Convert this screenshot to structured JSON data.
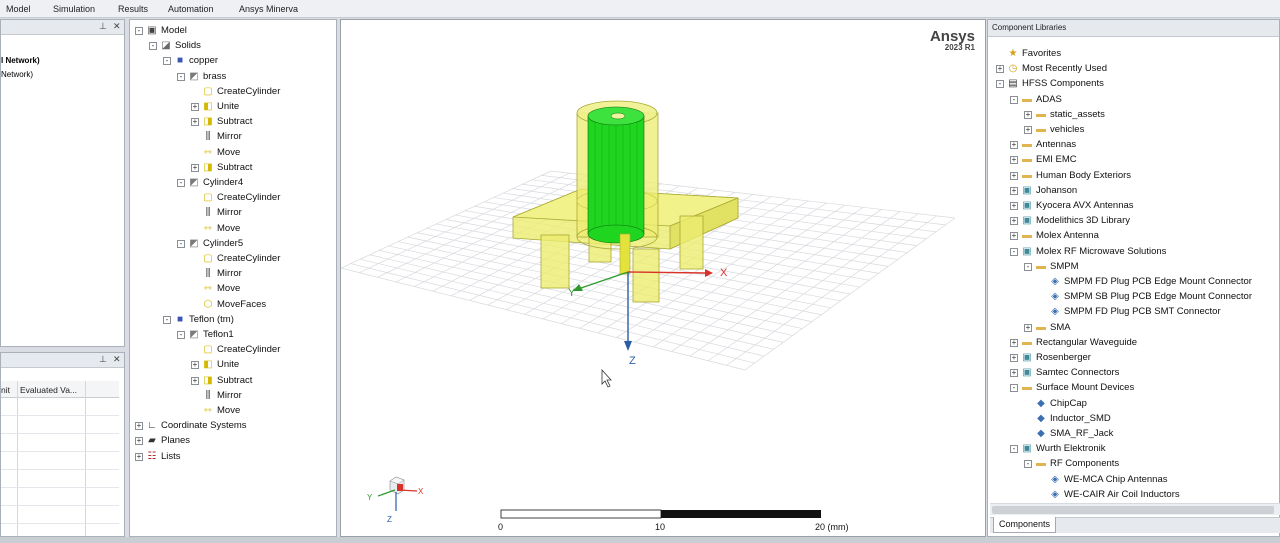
{
  "menu": [
    "Model",
    "Simulation",
    "Results",
    "Automation",
    "Ansys Minerva"
  ],
  "left_panel": {
    "pin_icon": "pin-icon",
    "close_icon": "close-icon",
    "lines": [
      "l Network)",
      "Network)"
    ]
  },
  "props_panel": {
    "pin_icon": "pin-icon",
    "close_icon": "close-icon",
    "columns": [
      "nit",
      "Evaluated Va..."
    ]
  },
  "model_tree": [
    {
      "label": "Model",
      "depth": 0,
      "exp": "-",
      "icon": "model-icon"
    },
    {
      "label": "Solids",
      "depth": 1,
      "exp": "-",
      "icon": "solids-icon"
    },
    {
      "label": "copper",
      "depth": 2,
      "exp": "-",
      "icon": "material-icon"
    },
    {
      "label": "brass",
      "depth": 3,
      "exp": "-",
      "icon": "solid-icon"
    },
    {
      "label": "CreateCylinder",
      "depth": 4,
      "exp": "",
      "icon": "create-cylinder-icon"
    },
    {
      "label": "Unite",
      "depth": 4,
      "exp": "+",
      "icon": "unite-icon"
    },
    {
      "label": "Subtract",
      "depth": 4,
      "exp": "+",
      "icon": "subtract-icon"
    },
    {
      "label": "Mirror",
      "depth": 4,
      "exp": "",
      "icon": "mirror-icon"
    },
    {
      "label": "Move",
      "depth": 4,
      "exp": "",
      "icon": "move-icon"
    },
    {
      "label": "Subtract",
      "depth": 4,
      "exp": "+",
      "icon": "subtract-icon"
    },
    {
      "label": "Cylinder4",
      "depth": 3,
      "exp": "-",
      "icon": "solid-icon"
    },
    {
      "label": "CreateCylinder",
      "depth": 4,
      "exp": "",
      "icon": "create-cylinder-icon"
    },
    {
      "label": "Mirror",
      "depth": 4,
      "exp": "",
      "icon": "mirror-icon"
    },
    {
      "label": "Move",
      "depth": 4,
      "exp": "",
      "icon": "move-icon"
    },
    {
      "label": "Cylinder5",
      "depth": 3,
      "exp": "-",
      "icon": "solid-icon"
    },
    {
      "label": "CreateCylinder",
      "depth": 4,
      "exp": "",
      "icon": "create-cylinder-icon"
    },
    {
      "label": "Mirror",
      "depth": 4,
      "exp": "",
      "icon": "mirror-icon"
    },
    {
      "label": "Move",
      "depth": 4,
      "exp": "",
      "icon": "move-icon"
    },
    {
      "label": "MoveFaces",
      "depth": 4,
      "exp": "",
      "icon": "move-faces-icon"
    },
    {
      "label": "Teflon (tm)",
      "depth": 2,
      "exp": "-",
      "icon": "material-icon"
    },
    {
      "label": "Teflon1",
      "depth": 3,
      "exp": "-",
      "icon": "solid-icon"
    },
    {
      "label": "CreateCylinder",
      "depth": 4,
      "exp": "",
      "icon": "create-cylinder-icon"
    },
    {
      "label": "Unite",
      "depth": 4,
      "exp": "+",
      "icon": "unite-icon"
    },
    {
      "label": "Subtract",
      "depth": 4,
      "exp": "+",
      "icon": "subtract-icon"
    },
    {
      "label": "Mirror",
      "depth": 4,
      "exp": "",
      "icon": "mirror-icon"
    },
    {
      "label": "Move",
      "depth": 4,
      "exp": "",
      "icon": "move-icon"
    },
    {
      "label": "Coordinate Systems",
      "depth": 0,
      "exp": "+",
      "icon": "coordinate-systems-icon"
    },
    {
      "label": "Planes",
      "depth": 0,
      "exp": "+",
      "icon": "planes-icon"
    },
    {
      "label": "Lists",
      "depth": 0,
      "exp": "+",
      "icon": "lists-icon"
    }
  ],
  "viewport": {
    "brand": "Ansys",
    "version": "2023 R1",
    "axis_x": "X",
    "axis_y": "Y",
    "axis_z": "Z",
    "triad_x": "X",
    "triad_y": "Y",
    "triad_z": "Z",
    "scale_labels": [
      "0",
      "10",
      "20 (mm)"
    ]
  },
  "component_libraries": {
    "title": "Component Libraries",
    "tab": "Components",
    "items": [
      {
        "label": "Favorites",
        "depth": 0,
        "exp": "",
        "icon": "favorites-icon"
      },
      {
        "label": "Most Recently Used",
        "depth": 0,
        "exp": "+",
        "icon": "recent-icon"
      },
      {
        "label": "HFSS Components",
        "depth": 0,
        "exp": "-",
        "icon": "hfss-icon"
      },
      {
        "label": "ADAS",
        "depth": 1,
        "exp": "-",
        "icon": "folder-icon"
      },
      {
        "label": "static_assets",
        "depth": 2,
        "exp": "+",
        "icon": "folder-icon"
      },
      {
        "label": "vehicles",
        "depth": 2,
        "exp": "+",
        "icon": "folder-icon"
      },
      {
        "label": "Antennas",
        "depth": 1,
        "exp": "+",
        "icon": "folder-icon"
      },
      {
        "label": "EMI EMC",
        "depth": 1,
        "exp": "+",
        "icon": "folder-icon"
      },
      {
        "label": "Human Body Exteriors",
        "depth": 1,
        "exp": "+",
        "icon": "folder-icon"
      },
      {
        "label": "Johanson",
        "depth": 1,
        "exp": "+",
        "icon": "vendor-icon"
      },
      {
        "label": "Kyocera AVX Antennas",
        "depth": 1,
        "exp": "+",
        "icon": "vendor-icon"
      },
      {
        "label": "Modelithics 3D Library",
        "depth": 1,
        "exp": "+",
        "icon": "vendor-icon"
      },
      {
        "label": "Molex Antenna",
        "depth": 1,
        "exp": "+",
        "icon": "folder-icon"
      },
      {
        "label": "Molex RF Microwave Solutions",
        "depth": 1,
        "exp": "-",
        "icon": "vendor-icon"
      },
      {
        "label": "SMPM",
        "depth": 2,
        "exp": "-",
        "icon": "folder-icon"
      },
      {
        "label": "SMPM FD Plug PCB Edge Mount Connector",
        "depth": 3,
        "exp": "",
        "icon": "component-icon"
      },
      {
        "label": "SMPM SB Plug PCB Edge Mount Connector",
        "depth": 3,
        "exp": "",
        "icon": "component-icon"
      },
      {
        "label": "SMPM FD Plug PCB SMT Connector",
        "depth": 3,
        "exp": "",
        "icon": "component-icon"
      },
      {
        "label": "SMA",
        "depth": 2,
        "exp": "+",
        "icon": "folder-icon"
      },
      {
        "label": "Rectangular Waveguide",
        "depth": 1,
        "exp": "+",
        "icon": "folder-icon"
      },
      {
        "label": "Rosenberger",
        "depth": 1,
        "exp": "+",
        "icon": "vendor-icon"
      },
      {
        "label": "Samtec Connectors",
        "depth": 1,
        "exp": "+",
        "icon": "vendor-icon"
      },
      {
        "label": "Surface Mount Devices",
        "depth": 1,
        "exp": "-",
        "icon": "folder-icon"
      },
      {
        "label": "ChipCap",
        "depth": 2,
        "exp": "",
        "icon": "component-small-icon"
      },
      {
        "label": "Inductor_SMD",
        "depth": 2,
        "exp": "",
        "icon": "component-small-icon"
      },
      {
        "label": "SMA_RF_Jack",
        "depth": 2,
        "exp": "",
        "icon": "component-small-icon"
      },
      {
        "label": "Wurth Elektronik",
        "depth": 1,
        "exp": "-",
        "icon": "vendor-icon"
      },
      {
        "label": "RF Components",
        "depth": 2,
        "exp": "-",
        "icon": "folder-icon"
      },
      {
        "label": "WE-MCA Chip Antennas",
        "depth": 3,
        "exp": "",
        "icon": "component-icon"
      },
      {
        "label": "WE-CAIR Air Coil Inductors",
        "depth": 3,
        "exp": "",
        "icon": "component-icon"
      }
    ]
  },
  "colors": {
    "green_part": "#1fd51f",
    "yellow_part": "#f0f06a",
    "axis_x": "#d9322b",
    "axis_y": "#2e9a2e",
    "axis_z": "#2c5ea8"
  }
}
